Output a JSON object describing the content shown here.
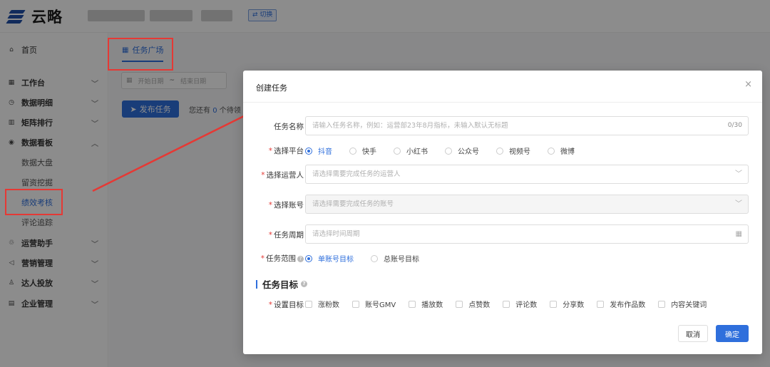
{
  "header": {
    "logo_text": "云略",
    "switch_label": "⇄ 切换"
  },
  "sidebar": {
    "home": "首页",
    "workbench": "工作台",
    "data_detail": "数据明细",
    "matrix_rank": "矩阵排行",
    "data_board": "数据看板",
    "sub_items": [
      "数据大盘",
      "留资挖掘",
      "绩效考核",
      "评论追踪"
    ],
    "ops_assistant": "运营助手",
    "marketing": "营销管理",
    "influencer": "达人投放",
    "enterprise": "企业管理"
  },
  "main": {
    "tab_label": "任务广场",
    "date_start": "开始日期",
    "date_sep": "~",
    "date_end": "结束日期",
    "publish_button": "发布任务",
    "pending_prefix": "您还有",
    "pending_count": "0",
    "pending_suffix": "个待领"
  },
  "dialog": {
    "title": "创建任务",
    "close": "×",
    "task_name": {
      "label": "任务名称",
      "placeholder": "请输入任务名称，例如：运营部23年8月指标，未输入默认无标题",
      "counter": "0/30"
    },
    "platform": {
      "label": "选择平台",
      "options": [
        "抖音",
        "快手",
        "小红书",
        "公众号",
        "视频号",
        "微博"
      ],
      "selected": "抖音"
    },
    "operator": {
      "label": "选择运营人",
      "placeholder": "请选择需要完成任务的运营人"
    },
    "account": {
      "label": "选择账号",
      "placeholder": "请选择需要完成任务的账号"
    },
    "period": {
      "label": "任务周期",
      "placeholder": "请选择时间周期"
    },
    "scope": {
      "label": "任务范围",
      "options": [
        "单账号目标",
        "总账号目标"
      ],
      "selected": "单账号目标"
    },
    "target_section": "任务目标",
    "set_target": {
      "label": "设置目标",
      "options": [
        "涨粉数",
        "账号GMV",
        "播放数",
        "点赞数",
        "评论数",
        "分享数",
        "发布作品数",
        "内容关键词"
      ]
    },
    "cancel_button": "取消",
    "ok_button": "确定"
  },
  "colors": {
    "accent": "#2f6fdc",
    "annotation": "#e53935",
    "required": "#e53935"
  },
  "icons": [
    "home-icon",
    "grid-icon",
    "clock-icon",
    "bar-chart-icon",
    "board-icon",
    "assistant-icon",
    "megaphone-icon",
    "user-icon",
    "building-icon",
    "send-icon",
    "calendar-icon",
    "close-icon",
    "chevron-down-icon",
    "question-icon"
  ]
}
